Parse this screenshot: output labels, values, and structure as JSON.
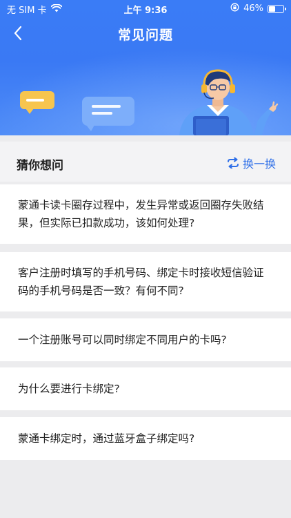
{
  "status_bar": {
    "carrier": "无 SIM 卡",
    "time": "上午 9:36",
    "battery": "46%",
    "battery_level": 0.46
  },
  "nav": {
    "title": "常见问题"
  },
  "guess": {
    "title": "猜你想问",
    "refresh_label": "换一换"
  },
  "questions": [
    {
      "text": "蒙通卡读卡圈存过程中，发生异常或返回圈存失败结果，但实际已扣款成功，该如何处理?"
    },
    {
      "text": "客户注册时填写的手机号码、绑定卡时接收短信验证码的手机号码是否一致？有何不同?"
    },
    {
      "text": "一个注册账号可以同时绑定不同用户的卡吗?"
    },
    {
      "text": "为什么要进行卡绑定?"
    },
    {
      "text": "蒙通卡绑定时，通过蓝牙盒子绑定吗?"
    }
  ],
  "colors": {
    "header": "#3a7cf6",
    "accent": "#2f6fe8",
    "background": "#ececee"
  }
}
